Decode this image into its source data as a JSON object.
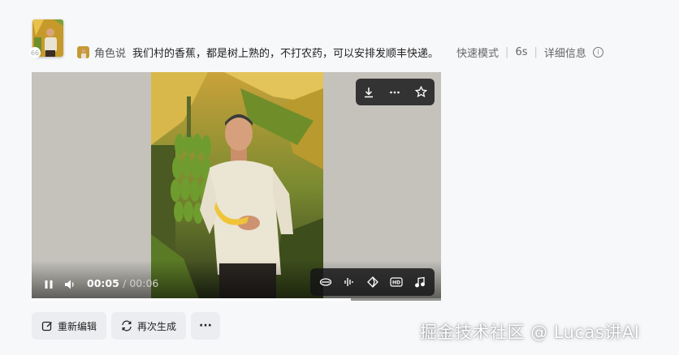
{
  "header": {
    "role_name": "角色说",
    "prompt": "我们村的香蕉，都是树上熟的，不打农药，可以安排发顺丰快递。",
    "mode": "快速模式",
    "duration": "6s",
    "details_label": "详细信息",
    "avatar_badge": "66"
  },
  "player": {
    "current_time": "00:05",
    "total_time": "/ 00:06",
    "progress": 0.78,
    "top_toolbar": [
      "download-icon",
      "more-icon",
      "star-icon"
    ],
    "bottom_toolbar": [
      "lip-sync-icon",
      "audio-wave-icon",
      "diamond-icon",
      "hd-icon",
      "music-icon"
    ]
  },
  "actions": {
    "reedit": "重新编辑",
    "regenerate": "再次生成",
    "more": "···"
  },
  "watermark": "掘金技术社区 @ Lucas讲AI"
}
